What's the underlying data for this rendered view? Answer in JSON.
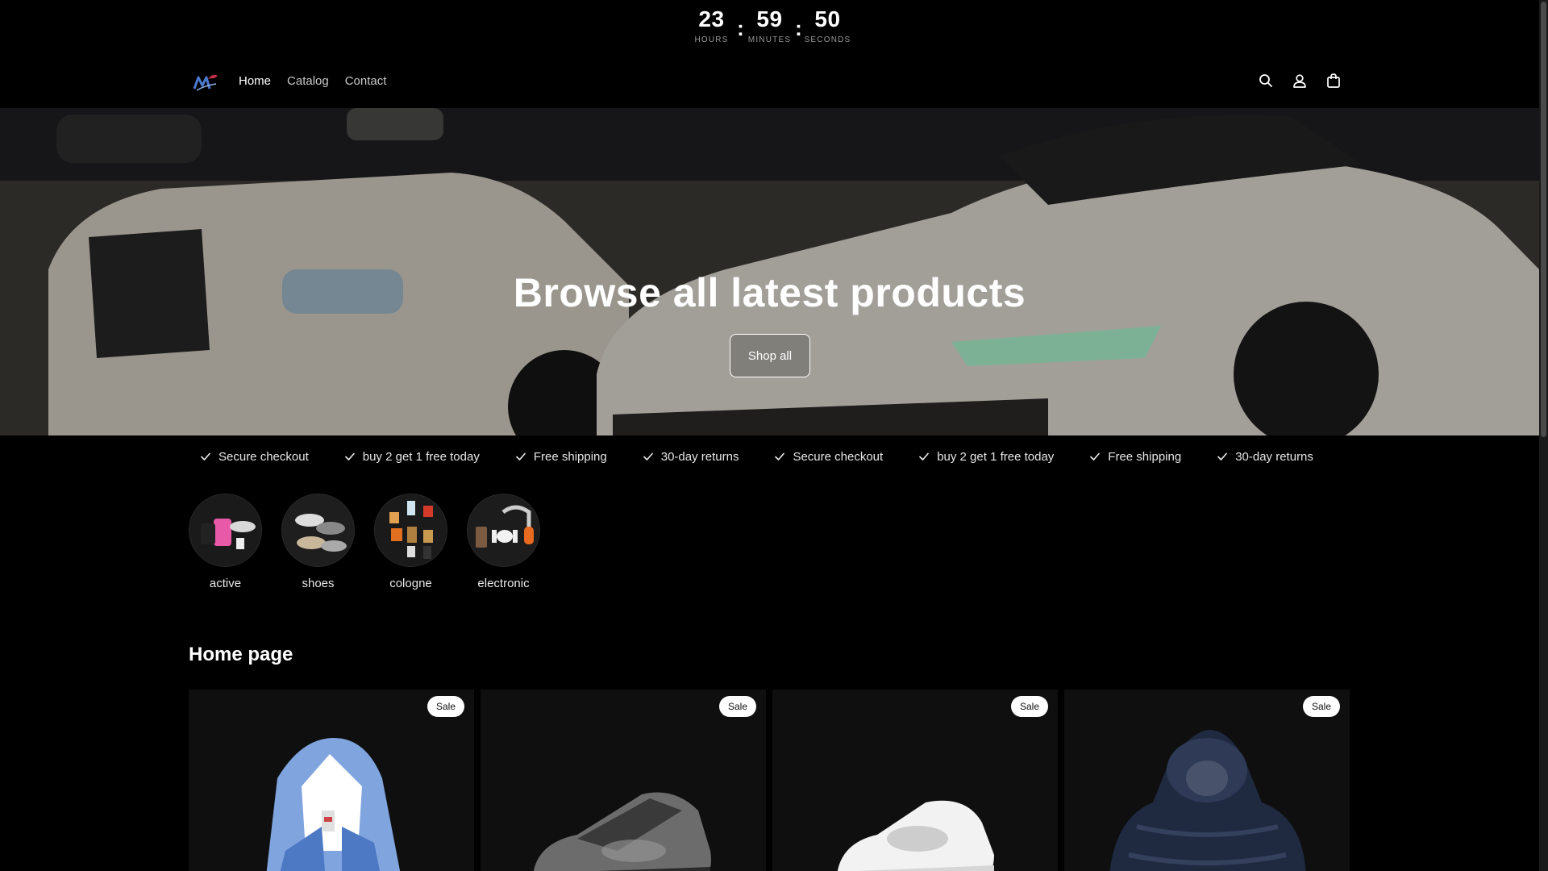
{
  "countdown": {
    "hours": "23",
    "hours_label": "HOURS",
    "minutes": "59",
    "minutes_label": "MINUTES",
    "seconds": "50",
    "seconds_label": "SECONDS",
    "separator": ":"
  },
  "header": {
    "logo_icon": "brand-logo",
    "nav": [
      {
        "label": "Home",
        "active": true
      },
      {
        "label": "Catalog",
        "active": false
      },
      {
        "label": "Contact",
        "active": false
      }
    ],
    "icons": [
      "search-icon",
      "account-icon",
      "cart-icon"
    ]
  },
  "hero": {
    "title": "Browse all latest products",
    "button_label": "Shop all"
  },
  "marquee": {
    "items": [
      "Secure checkout",
      "buy 2 get 1 free today",
      "Free shipping",
      "30-day returns",
      "Secure checkout",
      "buy 2 get 1 free today",
      "Free shipping",
      "30-day returns"
    ]
  },
  "categories": [
    {
      "label": "active"
    },
    {
      "label": "shoes"
    },
    {
      "label": "cologne"
    },
    {
      "label": "electronic"
    }
  ],
  "section": {
    "title": "Home page"
  },
  "products": [
    {
      "badge": "Sale"
    },
    {
      "badge": "Sale"
    },
    {
      "badge": "Sale"
    },
    {
      "badge": "Sale"
    }
  ],
  "colors": {
    "background": "#000000",
    "card": "#111111",
    "text": "#ffffff"
  }
}
